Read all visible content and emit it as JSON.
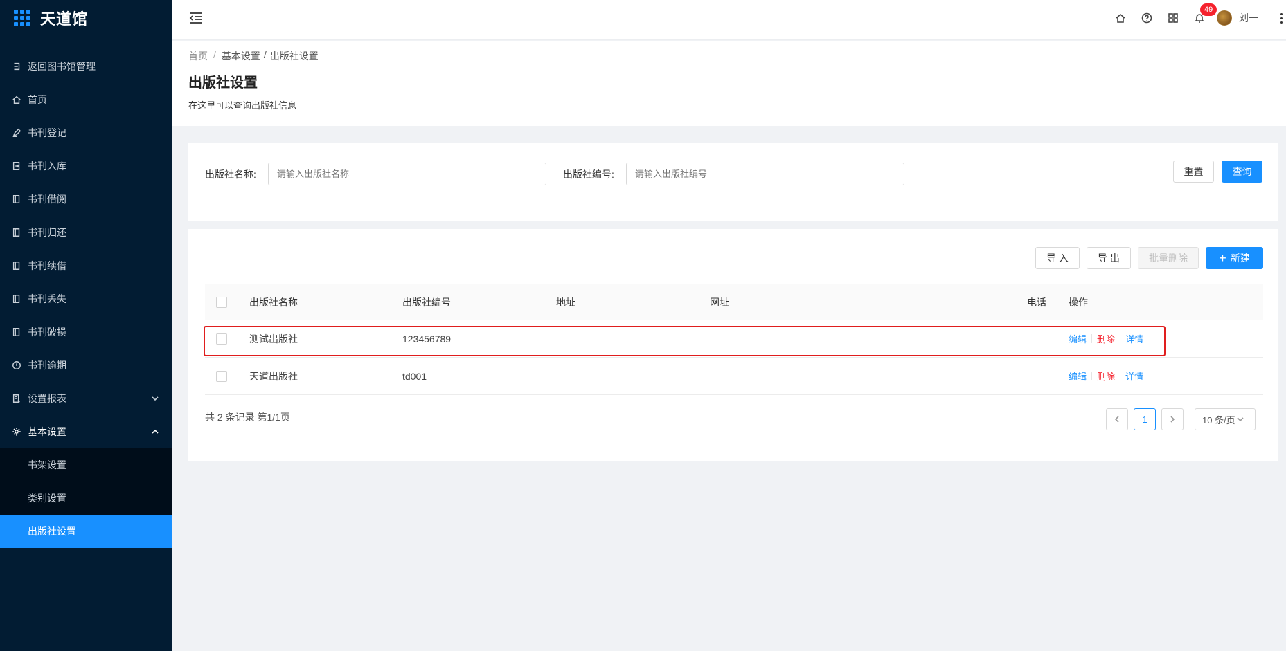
{
  "app": {
    "name": "天道馆"
  },
  "sidebar": {
    "items": [
      {
        "label": "返回图书馆管理",
        "icon": "return-icon"
      },
      {
        "label": "首页",
        "icon": "home-icon"
      },
      {
        "label": "书刊登记",
        "icon": "pen-icon"
      },
      {
        "label": "书刊入库",
        "icon": "import-icon"
      },
      {
        "label": "书刊借阅",
        "icon": "book-icon"
      },
      {
        "label": "书刊归还",
        "icon": "book-icon"
      },
      {
        "label": "书刊续借",
        "icon": "book-icon"
      },
      {
        "label": "书刊丢失",
        "icon": "book-icon"
      },
      {
        "label": "书刊破损",
        "icon": "book-icon"
      },
      {
        "label": "书刊逾期",
        "icon": "alert-circle-icon"
      },
      {
        "label": "设置报表",
        "icon": "report-icon"
      },
      {
        "label": "基本设置",
        "icon": "gear-icon"
      }
    ],
    "submenu": [
      {
        "label": "书架设置"
      },
      {
        "label": "类别设置"
      },
      {
        "label": "出版社设置"
      }
    ]
  },
  "header": {
    "notification_count": "49",
    "username": "刘一"
  },
  "breadcrumb": {
    "home": "首页",
    "sep": "/",
    "section": "基本设置",
    "current": "出版社设置"
  },
  "page": {
    "title": "出版社设置",
    "description": "在这里可以查询出版社信息"
  },
  "search": {
    "name_label": "出版社名称:",
    "name_placeholder": "请输入出版社名称",
    "code_label": "出版社编号:",
    "code_placeholder": "请输入出版社编号",
    "reset_label": "重置",
    "query_label": "查询"
  },
  "toolbar": {
    "import_label": "导 入",
    "export_label": "导 出",
    "batch_delete_label": "批量删除",
    "new_label": "新建"
  },
  "table": {
    "columns": [
      "出版社名称",
      "出版社编号",
      "地址",
      "网址",
      "电话",
      "操作"
    ],
    "rows": [
      {
        "name": "测试出版社",
        "code": "123456789",
        "address": "",
        "website": "",
        "phone": ""
      },
      {
        "name": "天道出版社",
        "code": "td001",
        "address": "",
        "website": "",
        "phone": ""
      }
    ],
    "actions": {
      "edit": "编辑",
      "delete": "删除",
      "detail": "详情"
    }
  },
  "pagination": {
    "summary": "共 2 条记录 第1/1页",
    "current_page": "1",
    "page_size": "10 条/页"
  },
  "colors": {
    "sidebar_bg": "#021c33",
    "accent": "#1890ff",
    "danger": "#f5222d",
    "highlight": "#e01e1e"
  }
}
